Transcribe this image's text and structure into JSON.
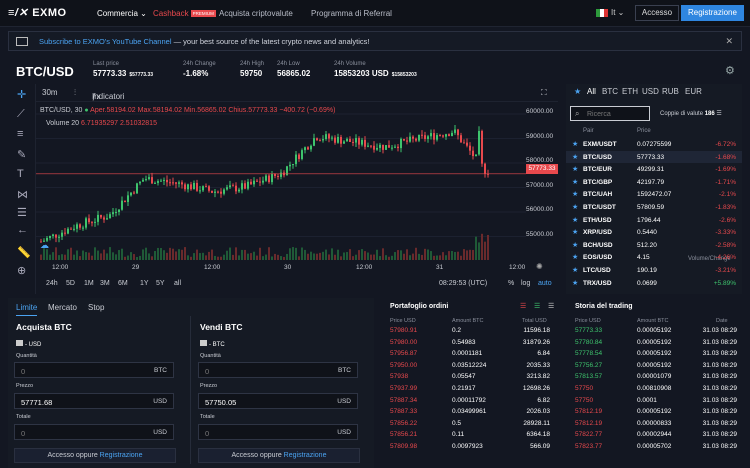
{
  "nav": {
    "logo": "EXMO",
    "commercia": "Commercia",
    "cashback": "Cashback",
    "premium": "PREMIUM",
    "acquista": "Acquista criptovalute",
    "referral": "Programma di Referral",
    "lang": "It",
    "login": "Accesso",
    "register": "Registrazione"
  },
  "banner": {
    "link": "Subscribe to EXMO's YouTube Channel",
    "rest": " — your best source of the latest crypto news and analytics!"
  },
  "ticker": {
    "pair": "BTC/USD",
    "last_label": "Last price",
    "last": "57773.33",
    "last_usd": "$57773.33",
    "change_label": "24h Change",
    "change": "-1.68%",
    "high_label": "24h High",
    "high": "59750",
    "low_label": "24h Low",
    "low": "56865.02",
    "vol_label": "24h Volume",
    "vol": "15853203 USD",
    "vol_usd": "$15853203"
  },
  "chart": {
    "tf": "30m",
    "indicators": "Indicatori",
    "ohlc_pair": "BTC/USD, 30",
    "o": "Aper.58194.02",
    "h": "Max.58194.02",
    "l": "Min.56865.02",
    "c": "Chius.57773.33",
    "delta": "−400.72 (−0.69%)",
    "vol_label": "Volume 20",
    "vol_vals": "6.71935297  2.51032815",
    "y_ticks": [
      "60000.00",
      "59000.00",
      "58000.00",
      "57000.00",
      "56000.00",
      "55000.00"
    ],
    "price_tag": "57773.33",
    "x_ticks": [
      "12:00",
      "29",
      "12:00",
      "30",
      "12:00",
      "31",
      "12:00"
    ],
    "ranges": [
      "5y",
      "1y",
      "6m",
      "3m",
      "1m",
      "5d",
      "1d"
    ],
    "ranges_labels": [
      "24h",
      "5D",
      "1M",
      "3M",
      "6M",
      "1Y",
      "5Y",
      "all"
    ],
    "time": "08:29:53 (UTC)",
    "pct": "%",
    "log": "log",
    "auto": "auto"
  },
  "chart_data": {
    "type": "candlestick",
    "title": "BTC/USD, 30",
    "ylim": [
      54500,
      60500
    ],
    "ylabel": "",
    "x": [
      "28 12:00",
      "29",
      "29 12:00",
      "30",
      "30 12:00",
      "31",
      "31 12:00"
    ],
    "close_approx": [
      55200,
      55800,
      56200,
      57600,
      57400,
      57100,
      57300,
      57800,
      59200,
      59000,
      58800,
      59100,
      59400,
      57773.33
    ]
  },
  "market": {
    "tabs": [
      "All",
      "BTC",
      "ETH",
      "USD",
      "RUB",
      "EUR"
    ],
    "search": "Ricerca",
    "pairs_label": "Coppie di valute",
    "pairs_count": "186",
    "h_pair": "Pair",
    "h_price": "Price",
    "h_vol": "Volume/Change",
    "rows": [
      {
        "p": "EXM/USDT",
        "pr": "0.07275599",
        "ch": "-6.72%",
        "c": "red"
      },
      {
        "p": "BTC/USD",
        "pr": "57773.33",
        "ch": "-1.68%",
        "c": "red"
      },
      {
        "p": "BTC/EUR",
        "pr": "49299.31",
        "ch": "-1.69%",
        "c": "red"
      },
      {
        "p": "BTC/GBP",
        "pr": "42197.79",
        "ch": "-1.71%",
        "c": "red"
      },
      {
        "p": "BTC/UAH",
        "pr": "1592472.07",
        "ch": "-2.1%",
        "c": "red"
      },
      {
        "p": "BTC/USDT",
        "pr": "57809.59",
        "ch": "-1.83%",
        "c": "red"
      },
      {
        "p": "ETH/USD",
        "pr": "1796.44",
        "ch": "-2.6%",
        "c": "red"
      },
      {
        "p": "XRP/USD",
        "pr": "0.5440",
        "ch": "-3.33%",
        "c": "red"
      },
      {
        "p": "BCH/USD",
        "pr": "512.20",
        "ch": "-2.58%",
        "c": "red"
      },
      {
        "p": "EOS/USD",
        "pr": "4.15",
        "ch": "-4.26%",
        "c": "red"
      },
      {
        "p": "LTC/USD",
        "pr": "190.19",
        "ch": "-3.21%",
        "c": "red"
      },
      {
        "p": "TRX/USD",
        "pr": "0.0699",
        "ch": "+5.89%",
        "c": "green"
      }
    ]
  },
  "trade": {
    "tabs": [
      "Limite",
      "Mercato",
      "Stop"
    ],
    "buy_title": "Acquista BTC",
    "sell_title": "Vendi BTC",
    "buy_bal": "- USD",
    "sell_bal": "- BTC",
    "qty": "Quantità",
    "price": "Prezzo",
    "total": "Totale",
    "zero": "0",
    "buy_price": "57771.68",
    "sell_price": "57750.05",
    "btc": "BTC",
    "usd": "USD",
    "acc": "Accesso",
    "or": " oppure ",
    "reg": "Registrazione"
  },
  "book": {
    "title": "Portafoglio ordini",
    "h1": "Price USD",
    "h2": "Amount BTC",
    "h3": "Total USD",
    "rows": [
      [
        "57980.91",
        "0.2",
        "11596.18"
      ],
      [
        "57980.00",
        "0.54983",
        "31879.26"
      ],
      [
        "57956.87",
        "0.0001181",
        "6.84"
      ],
      [
        "57950.00",
        "0.03512224",
        "2035.33"
      ],
      [
        "57938",
        "0.05547",
        "3213.82"
      ],
      [
        "57937.99",
        "0.21917",
        "12698.26"
      ],
      [
        "57887.34",
        "0.00011792",
        "6.82"
      ],
      [
        "57887.33",
        "0.03499961",
        "2026.03"
      ],
      [
        "57856.22",
        "0.5",
        "28928.11"
      ],
      [
        "57856.21",
        "0.11",
        "6364.18"
      ],
      [
        "57809.98",
        "0.0097923",
        "566.09"
      ]
    ]
  },
  "history": {
    "title": "Storia del trading",
    "h1": "Price USD",
    "h2": "Amount BTC",
    "h3": "Date",
    "rows": [
      [
        "57773.33",
        "0.00005192",
        "31.03 08:29",
        "g"
      ],
      [
        "57780.84",
        "0.00005192",
        "31.03 08:29",
        "g"
      ],
      [
        "57778.54",
        "0.00005192",
        "31.03 08:29",
        "g"
      ],
      [
        "57756.27",
        "0.00005192",
        "31.03 08:29",
        "g"
      ],
      [
        "57813.57",
        "0.00001079",
        "31.03 08:29",
        "g"
      ],
      [
        "57750",
        "0.00810908",
        "31.03 08:29",
        "r"
      ],
      [
        "57750",
        "0.0001",
        "31.03 08:29",
        "r"
      ],
      [
        "57812.19",
        "0.00005192",
        "31.03 08:29",
        "r"
      ],
      [
        "57812.19",
        "0.00000833",
        "31.03 08:29",
        "r"
      ],
      [
        "57822.77",
        "0.00002944",
        "31.03 08:29",
        "r"
      ],
      [
        "57823.77",
        "0.00005702",
        "31.03 08:29",
        "r"
      ]
    ]
  }
}
